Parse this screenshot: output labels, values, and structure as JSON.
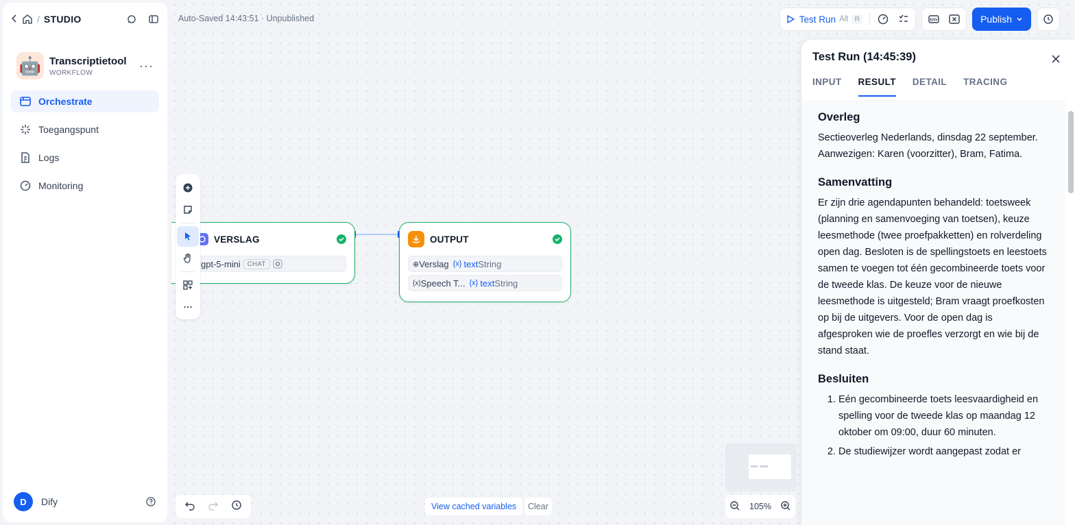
{
  "topbar": {
    "studio": "STUDIO"
  },
  "app": {
    "name": "Transcriptietool",
    "type": "WORKFLOW",
    "avatar": "🤖"
  },
  "nav": {
    "items": [
      {
        "label": "Orchestrate"
      },
      {
        "label": "Toegangspunt"
      },
      {
        "label": "Logs"
      },
      {
        "label": "Monitoring"
      }
    ]
  },
  "user": {
    "initial": "D",
    "name": "Dify"
  },
  "status": {
    "autosave": "Auto-Saved 14:43:51 · Unpublished"
  },
  "header": {
    "test_run": "Test Run",
    "shortcut_alt": "Alt",
    "shortcut_key": "R",
    "publish": "Publish"
  },
  "nodes": {
    "verslag": {
      "title": "VERSLAG",
      "model": "gpt-5-mini",
      "badge": "CHAT"
    },
    "output": {
      "title": "OUTPUT",
      "vars": [
        {
          "source": "Verslag",
          "name": "text",
          "type": "String"
        },
        {
          "source": "Speech T...",
          "name": "text",
          "type": "String"
        }
      ]
    }
  },
  "bottom": {
    "cached": "View cached variables",
    "clear": "Clear",
    "zoom": "105%"
  },
  "panel": {
    "title": "Test Run (14:45:39)",
    "tabs": [
      "INPUT",
      "RESULT",
      "DETAIL",
      "TRACING"
    ],
    "active_tab": "RESULT",
    "sections": {
      "overleg_title": "Overleg",
      "overleg_text": "Sectieoverleg Nederlands, dinsdag 22 september. Aanwezigen: Karen (voorzitter), Bram, Fatima.",
      "samenvatting_title": "Samenvatting",
      "samenvatting_text": "Er zijn drie agendapunten behandeld: toetsweek (planning en samenvoeging van toetsen), keuze leesmethode (twee proefpakketten) en rolverdeling open dag. Besloten is de spellingstoets en leestoets samen te voegen tot één gecombineerde toets voor de tweede klas. De keuze voor de nieuwe leesmethode is uitgesteld; Bram vraagt proefkosten op bij de uitgevers. Voor de open dag is afgesproken wie de proefles verzorgt en wie bij de stand staat.",
      "besluiten_title": "Besluiten",
      "besluiten": [
        "Eén gecombineerde toets leesvaardigheid en spelling voor de tweede klas op maandag 12 oktober om 09:00, duur 60 minuten.",
        "De studiewijzer wordt aangepast zodat er"
      ]
    }
  },
  "colors": {
    "accent": "#155eef",
    "success": "#17b26a"
  }
}
